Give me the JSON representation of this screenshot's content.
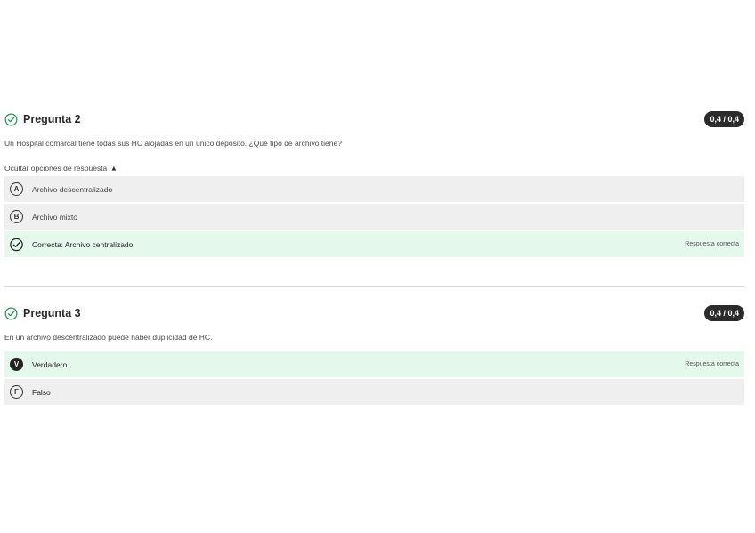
{
  "q2": {
    "title": "Pregunta 2",
    "score": "0,4 / 0,4",
    "text": "Un Hospital comarcal tiene todas sus HC alojadas en un único depósito. ¿Qué tipo de archivo tiene?",
    "toggle_label": "Ocultar opciones de respuesta",
    "options": [
      {
        "letter": "A",
        "label": "Archivo descentralizado"
      },
      {
        "letter": "B",
        "label": "Archivo mixto"
      },
      {
        "letter": "",
        "label": "Correcta: Archivo centralizado",
        "feedback": "Respuesta correcta"
      }
    ]
  },
  "q3": {
    "title": "Pregunta 3",
    "score": "0,4 / 0,4",
    "text": "En un archivo descentralizado puede haber duplicidad de HC.",
    "options": [
      {
        "letter": "V",
        "label": "Verdadero",
        "feedback": "Respuesta correcta"
      },
      {
        "letter": "F",
        "label": "Falso"
      }
    ]
  },
  "icons": {
    "question_status": "check-circle-icon",
    "toggle": "chevron-up-icon"
  },
  "colors": {
    "correct_bg": "#e5f8ec",
    "option_bg": "#efefef",
    "badge_bg": "#2b2b2b",
    "success": "#2e8b57"
  }
}
